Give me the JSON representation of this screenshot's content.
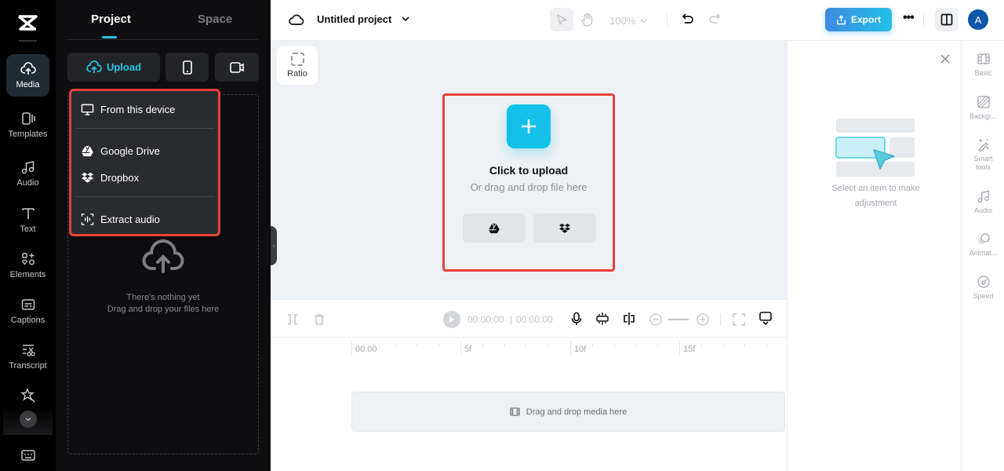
{
  "app": {
    "name": "CapCut"
  },
  "rail": {
    "items": [
      {
        "label": "Media",
        "icon": "cloud-upload-icon",
        "active": true
      },
      {
        "label": "Templates",
        "icon": "templates-icon"
      },
      {
        "label": "Audio",
        "icon": "music-note-icon"
      },
      {
        "label": "Text",
        "icon": "text-icon"
      },
      {
        "label": "Elements",
        "icon": "elements-icon"
      },
      {
        "label": "Captions",
        "icon": "captions-icon"
      },
      {
        "label": "Transcript",
        "icon": "transcript-icon"
      },
      {
        "label": "Effects",
        "icon": "effects-icon"
      }
    ]
  },
  "panel": {
    "tabs": [
      {
        "label": "Project",
        "active": true
      },
      {
        "label": "Space"
      }
    ],
    "upload_label": "Upload",
    "empty_line1": "There's nothing yet",
    "empty_line2": "Drag and drop your files here",
    "menu": {
      "items": [
        {
          "label": "From this device",
          "icon": "monitor-icon"
        },
        {
          "label": "Google Drive",
          "icon": "google-drive-icon"
        },
        {
          "label": "Dropbox",
          "icon": "dropbox-icon"
        },
        {
          "label": "Extract audio",
          "icon": "extract-audio-icon"
        }
      ]
    }
  },
  "topbar": {
    "project_title": "Untitled project",
    "zoom_level": "100%",
    "export_label": "Export",
    "avatar_initial": "A"
  },
  "canvas": {
    "ratio_label": "Ratio",
    "upload_title": "Click to upload",
    "upload_sub": "Or drag and drop file here"
  },
  "timeline": {
    "current_time": "00:00:00",
    "total_time": "00:00:00",
    "ruler": [
      "00:00",
      "5f",
      "10f",
      "15f"
    ],
    "drop_hint": "Drag and drop media here"
  },
  "right_panel": {
    "hint_line1": "Select an item to make",
    "hint_line2": "adjustment",
    "tabs": [
      {
        "label": "Basic",
        "icon": "film-icon"
      },
      {
        "label": "Backgr...",
        "icon": "background-icon"
      },
      {
        "label": "Smart tools",
        "icon": "magic-wand-icon"
      },
      {
        "label": "Audio",
        "icon": "music-note-icon"
      },
      {
        "label": "Animat...",
        "icon": "animation-icon"
      },
      {
        "label": "Speed",
        "icon": "speed-icon"
      }
    ]
  },
  "colors": {
    "accent": "#22c6e4",
    "highlight_border": "#e8413e",
    "export_start": "#3f8ae0",
    "export_end": "#22bfe6",
    "avatar": "#0c57a8"
  }
}
